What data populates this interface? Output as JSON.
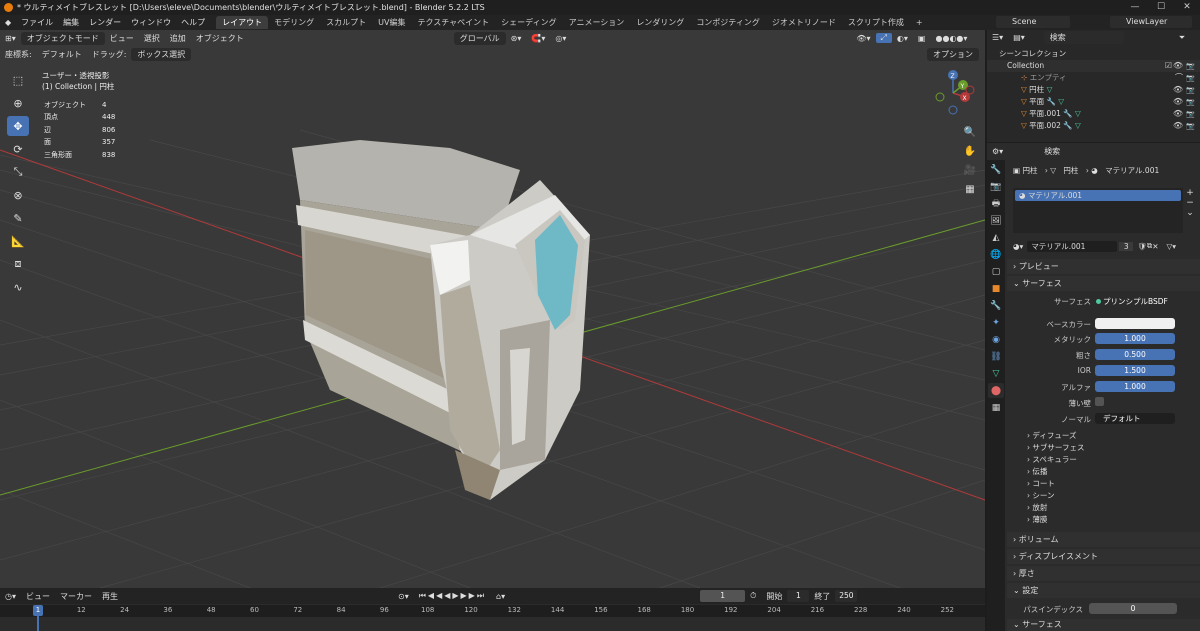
{
  "title_bar": {
    "title": "* ウルティメイトブレスレット [D:\\Users\\eleve\\Documents\\blender\\ウルティメイトブレスレット.blend] - Blender 5.2.2 LTS",
    "minimize": "—",
    "maximize": "☐",
    "close": "✕"
  },
  "menu": [
    "ファイル",
    "編集",
    "レンダー",
    "ウィンドウ",
    "ヘルプ"
  ],
  "workspaces": [
    "レイアウト",
    "モデリング",
    "スカルプト",
    "UV編集",
    "テクスチャペイント",
    "シェーディング",
    "アニメーション",
    "レンダリング",
    "コンポジティング",
    "ジオメトリノード",
    "スクリプト作成",
    "+"
  ],
  "scene": {
    "name": "Scene",
    "view_layer": "ViewLayer"
  },
  "viewport": {
    "mode": "オブジェクトモード",
    "menus": [
      "ビュー",
      "選択",
      "追加",
      "オブジェクト"
    ],
    "orientation": "グローバル",
    "coord_label": "座標系:",
    "coord_value": "デフォルト",
    "drag_label": "ドラッグ:",
    "drag_value": "ボックス選択",
    "options": "オプション",
    "view_name": "ユーザー・透視投影",
    "collection_info": "(1) Collection | 円柱",
    "stats": [
      {
        "label": "オブジェクト",
        "value": "4"
      },
      {
        "label": "頂点",
        "value": "448"
      },
      {
        "label": "辺",
        "value": "806"
      },
      {
        "label": "面",
        "value": "357"
      },
      {
        "label": "三角形面",
        "value": "838"
      }
    ],
    "gizmo": {
      "x": "X",
      "y": "Y",
      "z": "Z"
    }
  },
  "timeline": {
    "menus": [
      "ビュー",
      "マーカー",
      "再生"
    ],
    "current_frame": "1",
    "start_label": "開始",
    "start": "1",
    "end_label": "終了",
    "end": "250",
    "ticks": [
      "1",
      "12",
      "24",
      "36",
      "48",
      "60",
      "72",
      "84",
      "96",
      "108",
      "120",
      "132",
      "144",
      "156",
      "168",
      "180",
      "192",
      "204",
      "216",
      "228",
      "240",
      "252"
    ]
  },
  "outliner": {
    "search_placeholder": "検索",
    "root": "シーンコレクション",
    "collection": "Collection",
    "items": [
      {
        "name": "エンプティ",
        "dim": true
      },
      {
        "name": "円柱",
        "dim": false
      },
      {
        "name": "平面",
        "dim": false
      },
      {
        "name": "平面.001",
        "dim": false
      },
      {
        "name": "平面.002",
        "dim": false
      }
    ]
  },
  "properties": {
    "search_placeholder": "検索",
    "breadcrumb": [
      "円柱",
      "円柱",
      "マテリアル.001"
    ],
    "slot": "マテリアル.001",
    "material_name": "マテリアル.001",
    "users": "3",
    "panels": {
      "preview": "プレビュー",
      "surface": "サーフェス",
      "volume": "ボリューム",
      "displacement": "ディスプレイスメント",
      "thickness": "厚さ",
      "settings": "設定",
      "surface2": "サーフェス"
    },
    "surface_label": "サーフェス",
    "surface_value": "プリンシプルBSDF",
    "fields": [
      {
        "label": "ベースカラー",
        "value": ""
      },
      {
        "label": "メタリック",
        "value": "1.000"
      },
      {
        "label": "粗さ",
        "value": "0.500"
      },
      {
        "label": "IOR",
        "value": "1.500"
      },
      {
        "label": "アルファ",
        "value": "1.000"
      },
      {
        "label": "薄い壁",
        "value": ""
      },
      {
        "label": "ノーマル",
        "value": "デフォルト"
      }
    ],
    "subpanels": [
      "ディフューズ",
      "サブサーフェス",
      "スペキュラー",
      "伝播",
      "コート",
      "シーン",
      "放射",
      "薄膜"
    ],
    "pass_index_label": "パスインデックス",
    "pass_index": "0"
  },
  "colors": {
    "accent": "#4772b3",
    "x_axis": "#b43a3a",
    "y_axis": "#6a9c2c",
    "gem": "#5fb8c8"
  }
}
